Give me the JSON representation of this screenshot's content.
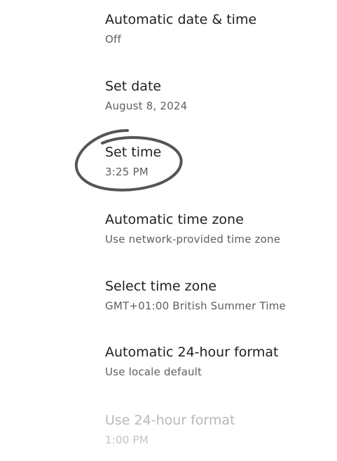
{
  "settings": {
    "items": [
      {
        "title": "Automatic date & time",
        "summary": "Off",
        "enabled": true
      },
      {
        "title": "Set date",
        "summary": "August 8, 2024",
        "enabled": true
      },
      {
        "title": "Set time",
        "summary": "3:25 PM",
        "enabled": true
      },
      {
        "title": "Automatic time zone",
        "summary": "Use network-provided time zone",
        "enabled": true
      },
      {
        "title": "Select time zone",
        "summary": "GMT+01:00 British Summer Time",
        "enabled": true
      },
      {
        "title": "Automatic 24-hour format",
        "summary": "Use locale default",
        "enabled": true
      },
      {
        "title": "Use 24-hour format",
        "summary": "1:00 PM",
        "enabled": false
      }
    ]
  },
  "colors": {
    "title_text": "#1f1f1f",
    "summary_text": "#5f5f5f",
    "disabled_text": "#b8b8b8",
    "annotation_stroke": "#555555"
  }
}
